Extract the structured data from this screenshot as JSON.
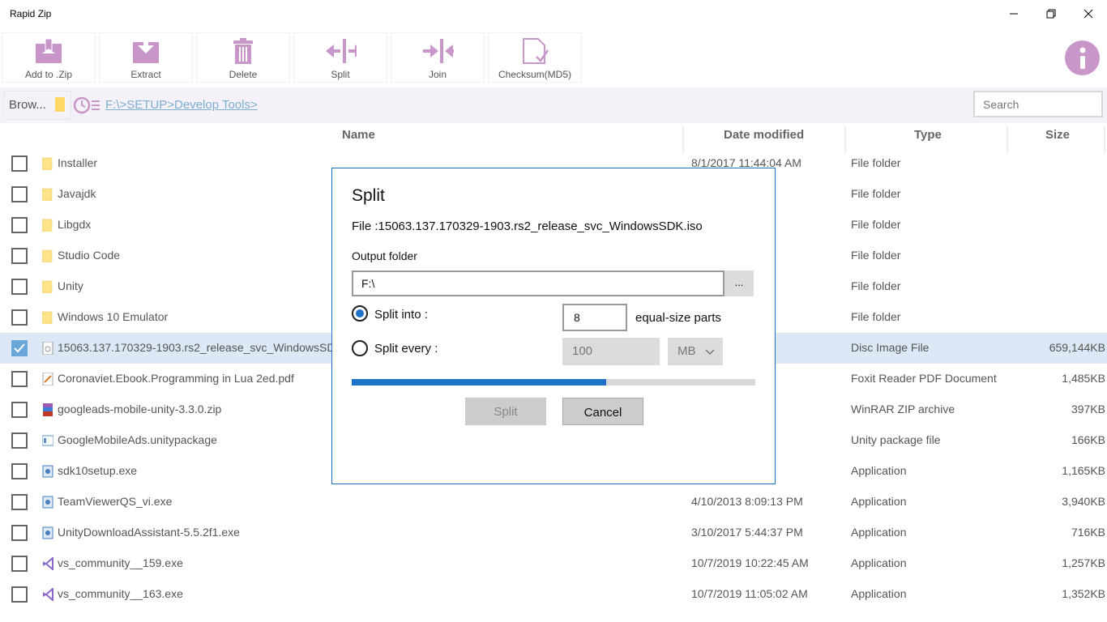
{
  "app": {
    "title": "Rapid Zip"
  },
  "toolbar": {
    "items": [
      {
        "label": "Add to .Zip",
        "icon": "add-to-zip-icon"
      },
      {
        "label": "Extract",
        "icon": "extract-icon"
      },
      {
        "label": "Delete",
        "icon": "delete-icon"
      },
      {
        "label": "Split",
        "icon": "split-icon"
      },
      {
        "label": "Join",
        "icon": "join-icon"
      },
      {
        "label": "Checksum(MD5)",
        "icon": "checksum-icon"
      }
    ],
    "icon_color": "#c996c9"
  },
  "address": {
    "browse_label": "Brow...",
    "path": "F:\\>SETUP>Develop Tools>",
    "search_placeholder": "Search"
  },
  "columns": {
    "name": "Name",
    "date": "Date modified",
    "type": "Type",
    "size": "Size"
  },
  "files": [
    {
      "name": "Installer",
      "date": "8/1/2017 11:44:04 AM",
      "type": "File folder",
      "size": "",
      "kind": "folder",
      "checked": false
    },
    {
      "name": "Javajdk",
      "date": "PM",
      "type": "File folder",
      "size": "",
      "kind": "folder",
      "checked": false
    },
    {
      "name": "Libgdx",
      "date": "1 AM",
      "type": "File folder",
      "size": "",
      "kind": "folder",
      "checked": false
    },
    {
      "name": "Studio Code",
      "date": "45 AM",
      "type": "File folder",
      "size": "",
      "kind": "folder",
      "checked": false
    },
    {
      "name": "Unity",
      "date": "PM",
      "type": "File folder",
      "size": "",
      "kind": "folder",
      "checked": false
    },
    {
      "name": "Windows 10 Emulator",
      "date": "2 PM",
      "type": "File folder",
      "size": "",
      "kind": "folder",
      "checked": false
    },
    {
      "name": "15063.137.170329-1903.rs2_release_svc_WindowsSDK.iso",
      "date": "54 AM",
      "type": "Disc Image File",
      "size": "659,144KB",
      "kind": "iso",
      "checked": true
    },
    {
      "name": "Coronaviet.Ebook.Programming in Lua 2ed.pdf",
      "date": "19 AM",
      "type": "Foxit Reader PDF Document",
      "size": "1,485KB",
      "kind": "pdf",
      "checked": false
    },
    {
      "name": "googleads-mobile-unity-3.3.0.zip",
      "date": "05 AM",
      "type": "WinRAR ZIP archive",
      "size": "397KB",
      "kind": "zip",
      "checked": false
    },
    {
      "name": "GoogleMobileAds.unitypackage",
      "date": "PM",
      "type": "Unity package file",
      "size": "166KB",
      "kind": "pkg",
      "checked": false
    },
    {
      "name": "sdk10setup.exe",
      "date": "PM",
      "type": "Application",
      "size": "1,165KB",
      "kind": "exe",
      "checked": false
    },
    {
      "name": "TeamViewerQS_vi.exe",
      "date": "4/10/2013 8:09:13 PM",
      "type": "Application",
      "size": "3,940KB",
      "kind": "exe",
      "checked": false
    },
    {
      "name": "UnityDownloadAssistant-5.5.2f1.exe",
      "date": "3/10/2017 5:44:37 PM",
      "type": "Application",
      "size": "716KB",
      "kind": "exe",
      "checked": false
    },
    {
      "name": "vs_community__159.exe",
      "date": "10/7/2019 10:22:45 AM",
      "type": "Application",
      "size": "1,257KB",
      "kind": "vs",
      "checked": false
    },
    {
      "name": "vs_community__163.exe",
      "date": "10/7/2019 11:05:02 AM",
      "type": "Application",
      "size": "1,352KB",
      "kind": "vs",
      "checked": false
    }
  ],
  "dialog": {
    "title": "Split",
    "file_label": "File :15063.137.170329-1903.rs2_release_svc_WindowsSDK.iso",
    "output_label": "Output folder",
    "output_value": "F:\\",
    "browse_label": "...",
    "split_into_label": "Split into :",
    "split_into_value": "8",
    "split_into_suffix": "equal-size parts",
    "split_every_label": "Split every :",
    "split_every_value": "100",
    "unit_value": "MB",
    "selected_option": "split_into",
    "progress": 0.63,
    "split_button": "Split",
    "cancel_button": "Cancel",
    "accent": "#1d73c9"
  }
}
